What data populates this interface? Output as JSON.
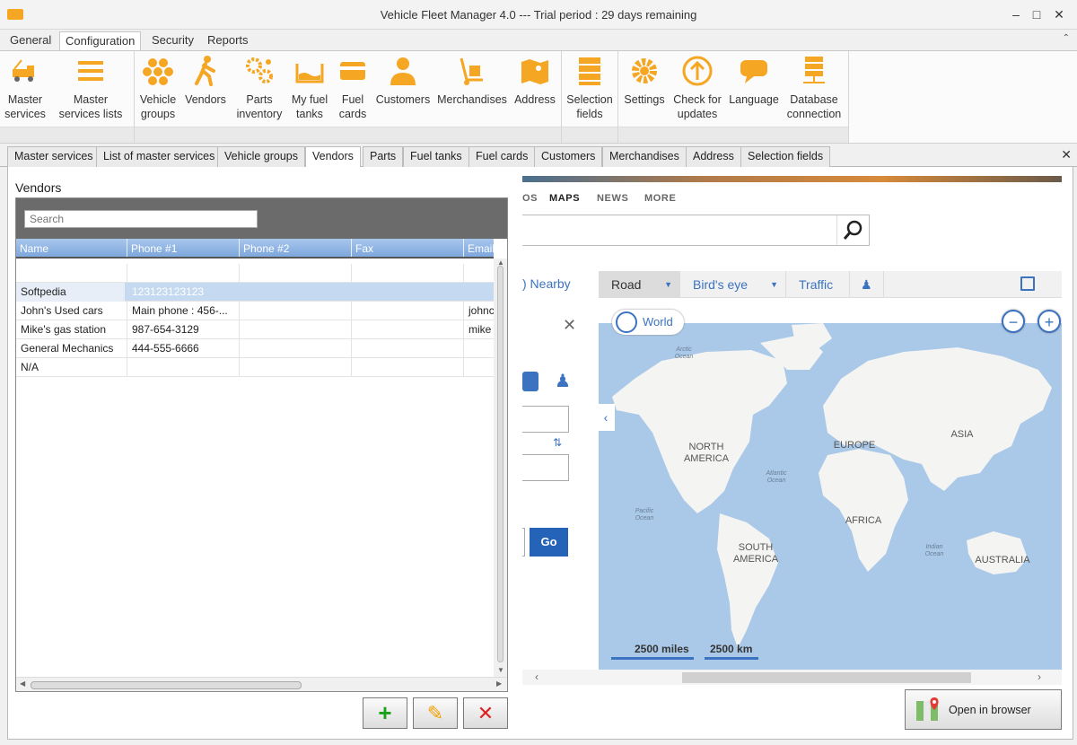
{
  "window": {
    "title": "Vehicle Fleet Manager 4.0 --- Trial period : 29 days remaining",
    "controls": [
      "minimize-icon",
      "maximize-icon",
      "close-icon"
    ]
  },
  "menu": {
    "tabs": [
      {
        "label": "General"
      },
      {
        "label": "Configuration",
        "active": true
      },
      {
        "label": "Security"
      },
      {
        "label": "Reports"
      }
    ]
  },
  "ribbon": {
    "accent": "#f5a623",
    "buttons": [
      {
        "label": "Master services",
        "icon": "tow-truck-icon"
      },
      {
        "label": "Master services lists",
        "icon": "list-icon"
      },
      {
        "label": "Vehicle groups",
        "icon": "hexagons-icon"
      },
      {
        "label": "Vendors",
        "icon": "walking-person-icon"
      },
      {
        "label": "Parts inventory",
        "icon": "gears-icon"
      },
      {
        "label": "My fuel tanks",
        "icon": "fuel-tank-icon"
      },
      {
        "label": "Fuel cards",
        "icon": "card-icon"
      },
      {
        "label": "Customers",
        "icon": "customer-icon"
      },
      {
        "label": "Merchandises",
        "icon": "hand-truck-icon"
      },
      {
        "label": "Address",
        "icon": "map-icon"
      },
      {
        "label": "Selection fields",
        "icon": "database-stack-icon"
      },
      {
        "label": "Settings",
        "icon": "gear-icon"
      },
      {
        "label": "Check for updates",
        "icon": "up-arrow-icon"
      },
      {
        "label": "Language",
        "icon": "speech-bubble-icon"
      },
      {
        "label": "Database connection",
        "icon": "network-database-icon"
      }
    ]
  },
  "doc_tabs": [
    {
      "label": "Master services"
    },
    {
      "label": "List of master services"
    },
    {
      "label": "Vehicle groups"
    },
    {
      "label": "Vendors",
      "active": true
    },
    {
      "label": "Parts"
    },
    {
      "label": "Fuel tanks"
    },
    {
      "label": "Fuel cards"
    },
    {
      "label": "Customers"
    },
    {
      "label": "Merchandises"
    },
    {
      "label": "Address"
    },
    {
      "label": "Selection fields"
    }
  ],
  "vendors": {
    "title": "Vendors",
    "search_placeholder": "Search",
    "columns": [
      "Name",
      "Phone #1",
      "Phone #2",
      "Fax",
      "Email"
    ],
    "rows": [
      [
        "",
        "",
        "",
        "",
        ""
      ],
      [
        "Softpedia",
        "123123123123",
        "",
        "",
        ""
      ],
      [
        "John's Used cars",
        "Main phone : 456-...",
        "",
        "",
        "johnc"
      ],
      [
        "Mike's gas station",
        "987-654-3129",
        "",
        "",
        "mike"
      ],
      [
        "General Mechanics",
        "444-555-6666",
        "",
        "",
        ""
      ],
      [
        "N/A",
        "",
        "",
        "",
        ""
      ]
    ],
    "selected_row": 1,
    "actions": [
      {
        "name": "add",
        "label": "+",
        "color": "#1aa31a"
      },
      {
        "name": "edit",
        "label": "✎",
        "color": "#f0a000"
      },
      {
        "name": "delete",
        "label": "✕",
        "color": "#e02020"
      }
    ]
  },
  "browser": {
    "nav": [
      {
        "label": "OS"
      },
      {
        "label": "MAPS",
        "active": true
      },
      {
        "label": "NEWS"
      },
      {
        "label": "MORE"
      }
    ],
    "nearby": ") Nearby",
    "map_tabs": [
      {
        "label": "Road",
        "active": true
      },
      {
        "label": "Bird's eye"
      },
      {
        "label": "Traffic"
      }
    ],
    "world_label": "World",
    "go_label": "Go",
    "continents": [
      "NORTH AMERICA",
      "EUROPE",
      "ASIA",
      "AFRICA",
      "SOUTH AMERICA",
      "AUSTRALIA"
    ],
    "oceans": [
      "Arctic Ocean",
      "Atlantic Ocean",
      "Pacific Ocean",
      "Indian Ocean"
    ],
    "scale": [
      "2500 miles",
      "2500 km"
    ],
    "open_label": "Open in browser"
  }
}
